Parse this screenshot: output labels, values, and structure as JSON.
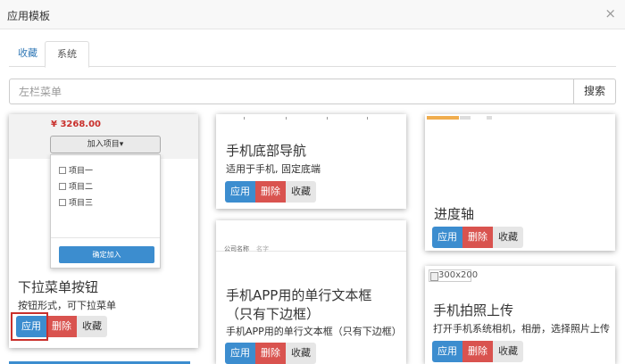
{
  "window": {
    "title": "应用模板",
    "close_glyph": "×"
  },
  "tabs": [
    {
      "label": "收藏"
    },
    {
      "label": "系统"
    }
  ],
  "search": {
    "placeholder": "左栏菜单",
    "button": "搜索"
  },
  "buttons": {
    "apply": "应用",
    "delete": "删除",
    "favorite": "收藏"
  },
  "cards": {
    "dropdown": {
      "title": "下拉菜单按钮",
      "desc": "按钮形式，可下拉菜单",
      "preview": {
        "price": "¥ 3268.00",
        "dropdown_label": "加入项目",
        "items": [
          "项目一",
          "项目二",
          "项目三"
        ],
        "confirm": "确定加入"
      }
    },
    "bottom_nav": {
      "title": "手机底部导航",
      "desc": "适用于手机, 固定底端"
    },
    "progress": {
      "title": "进度轴"
    },
    "text_input": {
      "title_line1": "手机APP用的单行文本框",
      "title_line2": "（只有下边框）",
      "desc": "手机APP用的单行文本框（只有下边框）",
      "preview": {
        "company": "公司名称",
        "name": "名字"
      }
    },
    "photo": {
      "title": "手机拍照上传",
      "desc": "打开手机系统相机，相册，选择照片上传",
      "image_alt": "300x200"
    }
  },
  "colors": {
    "primary": "#3c8dcf",
    "danger": "#d9534f",
    "default": "#e6e6e6",
    "progress_accent": "#f0ad4e"
  }
}
